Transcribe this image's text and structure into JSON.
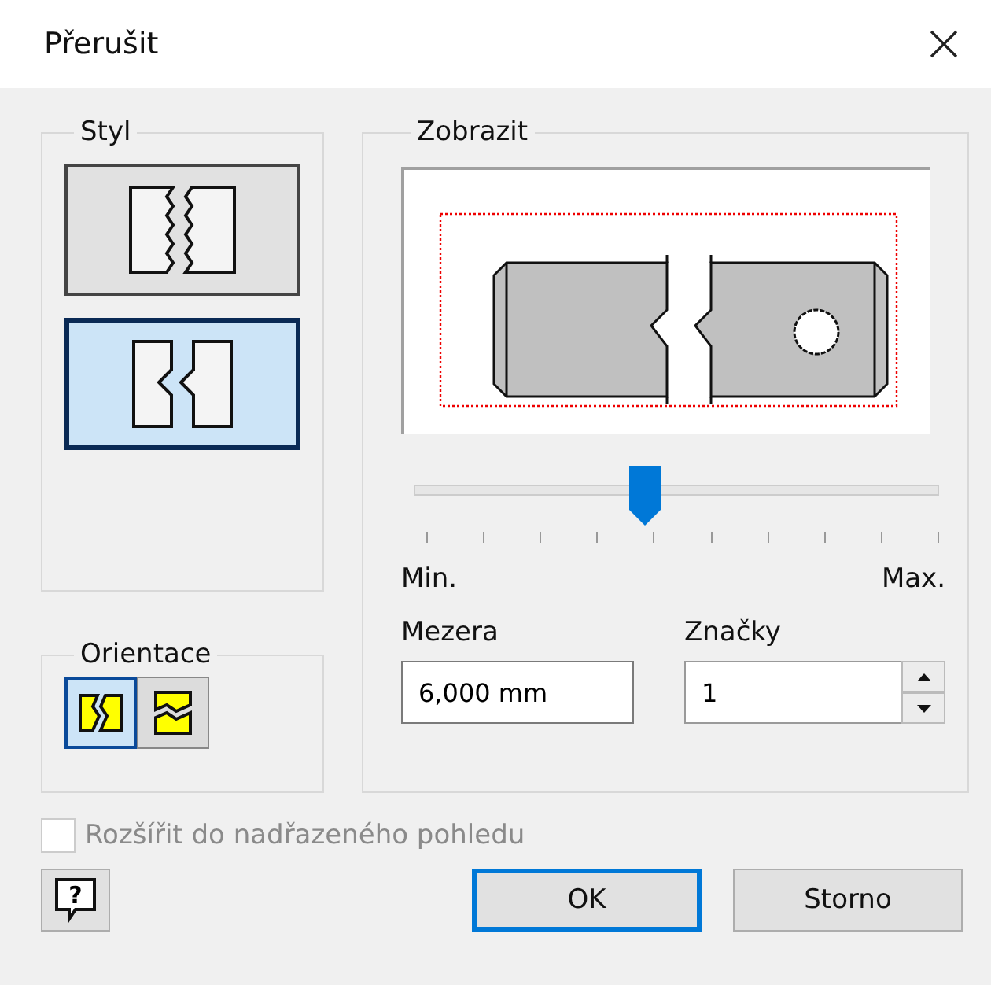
{
  "window": {
    "title": "Přerušit"
  },
  "style_group": {
    "label": "Styl",
    "options": [
      {
        "kind": "rectangular",
        "selected": false
      },
      {
        "kind": "structural",
        "selected": true
      }
    ]
  },
  "orientation_group": {
    "label": "Orientace",
    "options": [
      {
        "kind": "vertical",
        "selected": true
      },
      {
        "kind": "horizontal",
        "selected": false
      }
    ]
  },
  "display_group": {
    "label": "Zobrazit",
    "slider": {
      "level": 0.44,
      "min_label": "Min.",
      "max_label": "Max."
    },
    "gap": {
      "label": "Mezera",
      "value": "6,000 mm"
    },
    "marks": {
      "label": "Značky",
      "value": "1"
    }
  },
  "extend_checkbox": {
    "label": "Rozšířit do nadřazeného pohledu",
    "checked": false,
    "disabled": true
  },
  "help_button": {
    "label": "?"
  },
  "buttons": [
    {
      "label": "OK",
      "default": true
    },
    {
      "label": "Storno",
      "default": false
    }
  ]
}
